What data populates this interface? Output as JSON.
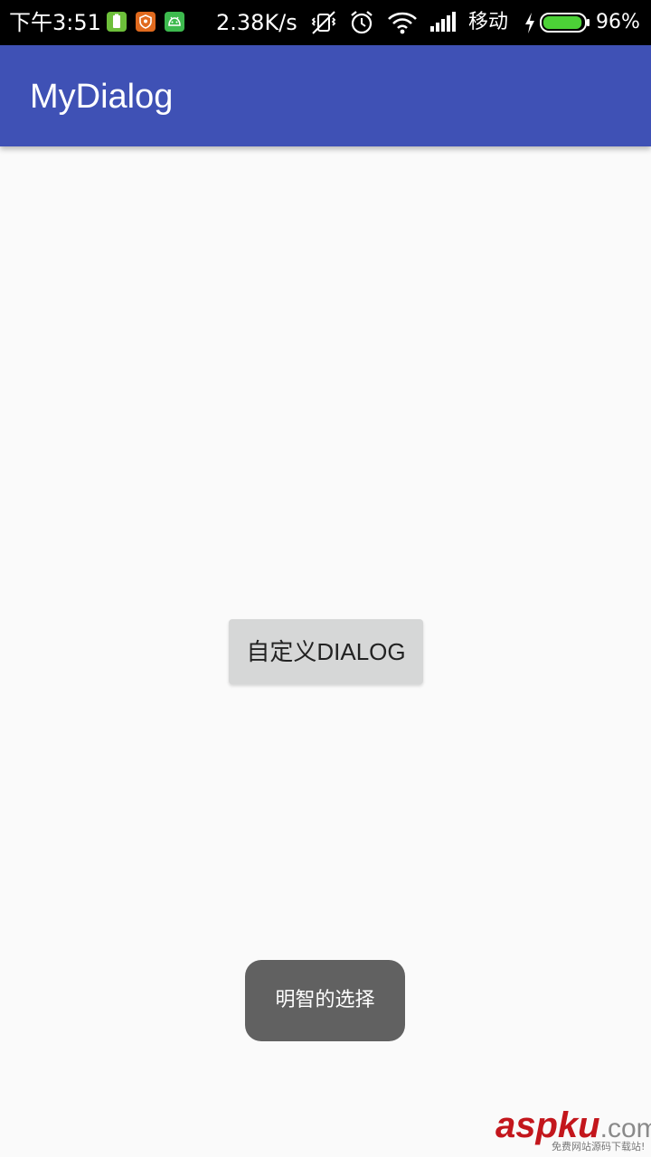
{
  "status_bar": {
    "time": "下午3:51",
    "net_speed": "2.38K/s",
    "carrier": "移动",
    "battery_percent": "96%",
    "battery_level": 0.96,
    "notification_icons": [
      "battery-app-icon",
      "shield-app-icon",
      "android-app-icon"
    ],
    "icon_colors": {
      "battery_app": "#6dbf3a",
      "shield_app": "#e06a1e",
      "android_app": "#3dba4e",
      "battery_fill": "#4cd137"
    }
  },
  "app_bar": {
    "title": "MyDialog",
    "color": "#3f51b5"
  },
  "main": {
    "button_label": "自定义DIALOG"
  },
  "toast": {
    "message": "明智的选择"
  },
  "watermark": {
    "brand": "aspku",
    "domain_suffix": ".com",
    "tagline": "免费网站源码下载站!"
  }
}
